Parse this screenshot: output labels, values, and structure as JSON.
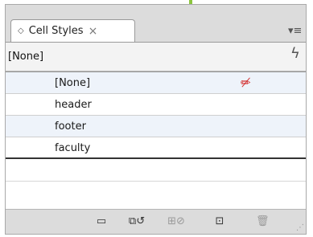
{
  "colors": {
    "accent": "#8cc63e",
    "selected_row": "#eef3fa",
    "clear_icon": "#d32f2f"
  },
  "window": {
    "minimize_glyph": "–",
    "close_glyph": "×"
  },
  "panel": {
    "tab_label": "Cell Styles",
    "tab_grip_icon": "◇",
    "tab_close_glyph": "×",
    "menu_icon": "▾≡",
    "current_style": "[None]",
    "quick_apply_icon": "ϟ"
  },
  "styles": [
    {
      "label": "[None]",
      "has_clear_icon": true
    },
    {
      "label": "header"
    },
    {
      "label": "footer"
    },
    {
      "label": "faculty"
    }
  ],
  "footer_tools": [
    {
      "name": "style-group-folder-icon",
      "glyph": "▭"
    },
    {
      "name": "clear-overrides-icon",
      "glyph": "⧉↺"
    },
    {
      "name": "break-link-icon",
      "glyph": "⊞⊘"
    },
    {
      "name": "new-style-icon",
      "glyph": "⊡"
    },
    {
      "name": "delete-style-icon",
      "glyph": "🗑"
    }
  ]
}
